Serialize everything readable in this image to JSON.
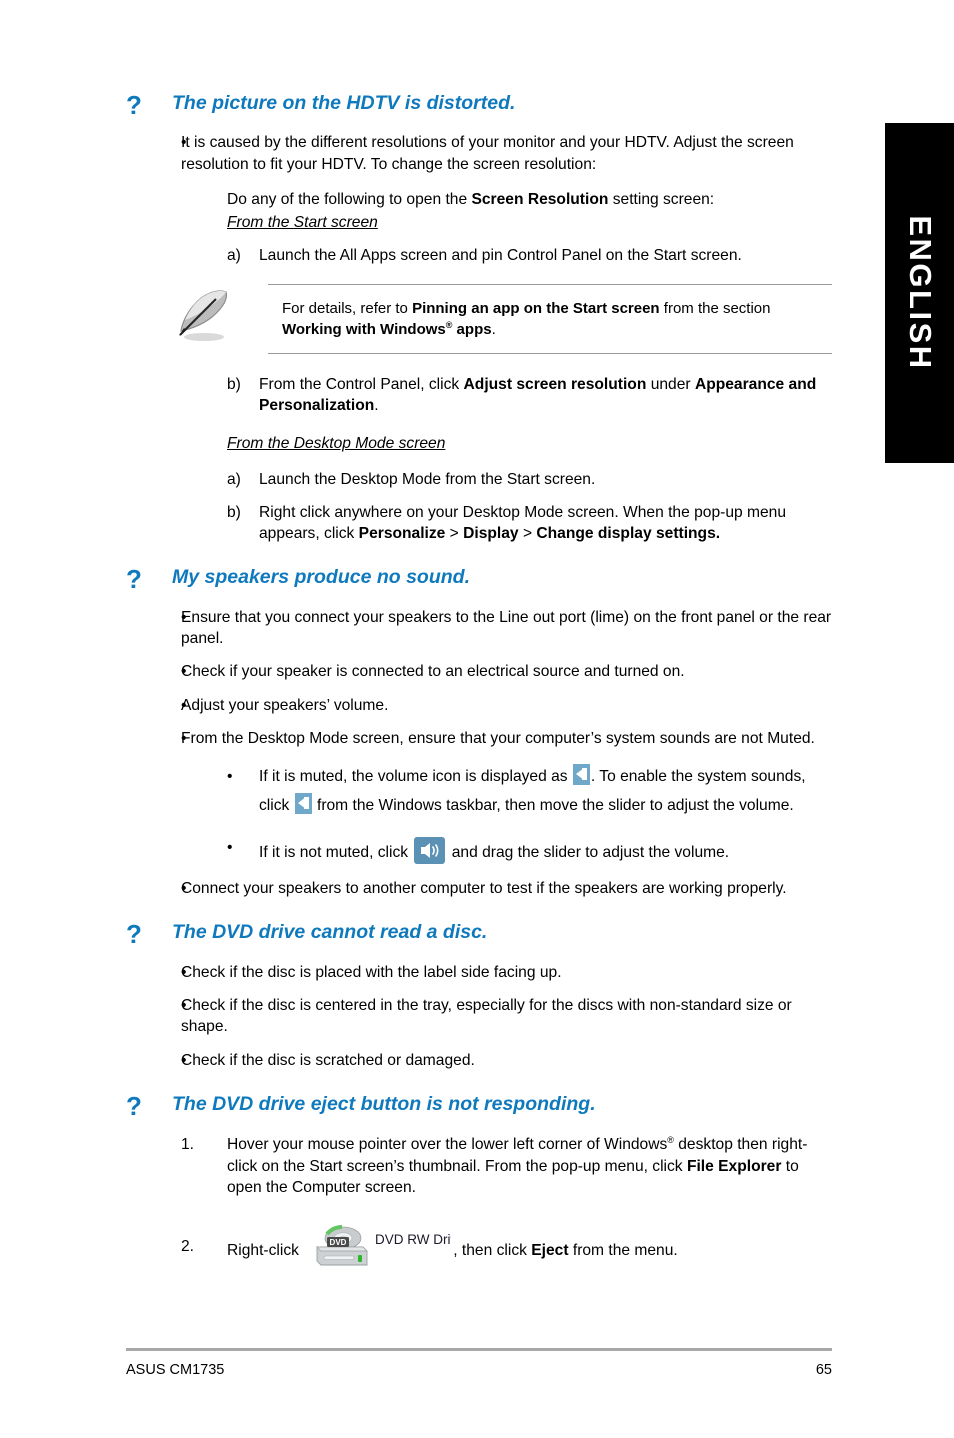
{
  "language_tab": {
    "label": "ENGLISH"
  },
  "footer": {
    "product": "ASUS CM1735",
    "page_number": "65"
  },
  "colors": {
    "heading_blue": "#0f79bd",
    "tab_black": "#000000",
    "rule_gray": "#a8a8a8",
    "icon_blue": "#5b91b5"
  },
  "sections": [
    {
      "q_mark": "?",
      "title": "The picture on the HDTV is distorted.",
      "bullets": [
        {
          "marker": "•",
          "text_parts": [
            {
              "t": "It is caused by the different resolutions of your monitor and your HDTV. Adjust the screen resolution to fit your HDTV. To change the screen resolution:",
              "b": false
            }
          ]
        }
      ],
      "para_lead": [
        {
          "t": "Do any of the following to open the ",
          "b": false
        },
        {
          "t": "Screen Resolution",
          "b": true
        },
        {
          "t": " setting screen:",
          "b": false
        }
      ],
      "subhead_1": "From the Start screen",
      "steps_1": [
        {
          "label": "a)",
          "parts": [
            {
              "t": "Launch the All Apps screen and pin Control Panel on the Start screen.",
              "b": false
            }
          ]
        }
      ],
      "note": {
        "icon": "quill-pen-icon",
        "parts": [
          {
            "t": "For details, refer to ",
            "b": false
          },
          {
            "t": "Pinning an app on the Start screen",
            "b": true
          },
          {
            "t": " from the section ",
            "b": false
          },
          {
            "t": "Working with Windows",
            "b": true
          },
          {
            "t": "®",
            "b": true,
            "sup": true
          },
          {
            "t": " apps",
            "b": true
          },
          {
            "t": ".",
            "b": false
          }
        ]
      },
      "steps_2": [
        {
          "label": "b)",
          "parts": [
            {
              "t": "From the Control Panel, click ",
              "b": false
            },
            {
              "t": "Adjust screen resolution",
              "b": true
            },
            {
              "t": " under ",
              "b": false
            },
            {
              "t": "Appearance and Personalization",
              "b": true
            },
            {
              "t": ".",
              "b": false
            }
          ]
        }
      ],
      "subhead_2": "From the Desktop Mode screen",
      "steps_3": [
        {
          "label": "a)",
          "parts": [
            {
              "t": "Launch the Desktop Mode from the Start screen.",
              "b": false
            }
          ]
        },
        {
          "label": "b)",
          "parts": [
            {
              "t": "Right click anywhere on your Desktop Mode screen. When the pop-up menu appears, click ",
              "b": false
            },
            {
              "t": "Personalize",
              "b": true
            },
            {
              "t": " > ",
              "b": false
            },
            {
              "t": "Display",
              "b": true
            },
            {
              "t": " > ",
              "b": false
            },
            {
              "t": "Change display settings.",
              "b": true
            }
          ]
        }
      ]
    },
    {
      "q_mark": "?",
      "title": "My speakers produce no sound.",
      "bullets": [
        {
          "marker": "•",
          "text_parts": [
            {
              "t": "Ensure that you connect your speakers to the Line out port (lime) on the front panel or the rear panel.",
              "b": false
            }
          ]
        },
        {
          "marker": "•",
          "text_parts": [
            {
              "t": "Check if your speaker is connected to an electrical source and turned on.",
              "b": false
            }
          ]
        },
        {
          "marker": "•",
          "text_parts": [
            {
              "t": "Adjust your speakers’ volume.",
              "b": false
            }
          ]
        },
        {
          "marker": "•",
          "text_parts": [
            {
              "t": "From the Desktop Mode screen, ensure that your computer’s system sounds are not Muted.",
              "b": false
            }
          ]
        }
      ],
      "sub_bullets": [
        {
          "marker": "•",
          "parts": [
            {
              "t": "If it is muted, the volume icon is displayed as ",
              "b": false
            },
            {
              "icon": "volume-muted-icon"
            },
            {
              "t": ". To enable the system sounds, click ",
              "b": false
            },
            {
              "icon": "volume-muted-icon"
            },
            {
              "t": " from the Windows taskbar, then move the slider to adjust the volume.",
              "b": false
            }
          ]
        },
        {
          "marker": "•",
          "parts": [
            {
              "t": "If it is not muted, click ",
              "b": false
            },
            {
              "icon": "volume-on-icon"
            },
            {
              "t": " and drag the slider to adjust the volume.",
              "b": false
            }
          ]
        }
      ],
      "bullets_tail": [
        {
          "marker": "•",
          "text_parts": [
            {
              "t": "Connect your speakers to another computer to test if the speakers are working properly.",
              "b": false
            }
          ]
        }
      ]
    },
    {
      "q_mark": "?",
      "title": "The DVD drive cannot read a disc.",
      "bullets": [
        {
          "marker": "•",
          "text_parts": [
            {
              "t": "Check if the disc is placed with the label side facing up.",
              "b": false
            }
          ]
        },
        {
          "marker": "•",
          "text_parts": [
            {
              "t": "Check if the disc is centered in the tray, especially for the discs with non-standard size or shape.",
              "b": false
            }
          ]
        },
        {
          "marker": "•",
          "text_parts": [
            {
              "t": "Check if the disc is scratched or damaged.",
              "b": false
            }
          ]
        }
      ]
    },
    {
      "q_mark": "?",
      "title": "The DVD drive eject button is not responding.",
      "numbered": [
        {
          "label": "1.",
          "parts": [
            {
              "t": "Hover your mouse pointer over the lower left corner of Windows",
              "b": false
            },
            {
              "t": "®",
              "b": false,
              "sup": true
            },
            {
              "t": " desktop then right-click on the Start screen’s thumbnail. From the pop-up menu, click ",
              "b": false
            },
            {
              "t": "File Explorer",
              "b": true
            },
            {
              "t": " to open the Computer screen.",
              "b": false
            }
          ]
        },
        {
          "label": "2.",
          "parts": [
            {
              "t": "Right-click ",
              "b": false
            },
            {
              "icon": "dvd-rw-drive-icon",
              "label": "DVD RW Drive"
            },
            {
              "t": ", then click ",
              "b": false
            },
            {
              "t": "Eject",
              "b": true
            },
            {
              "t": " from the menu.",
              "b": false
            }
          ]
        }
      ]
    }
  ]
}
